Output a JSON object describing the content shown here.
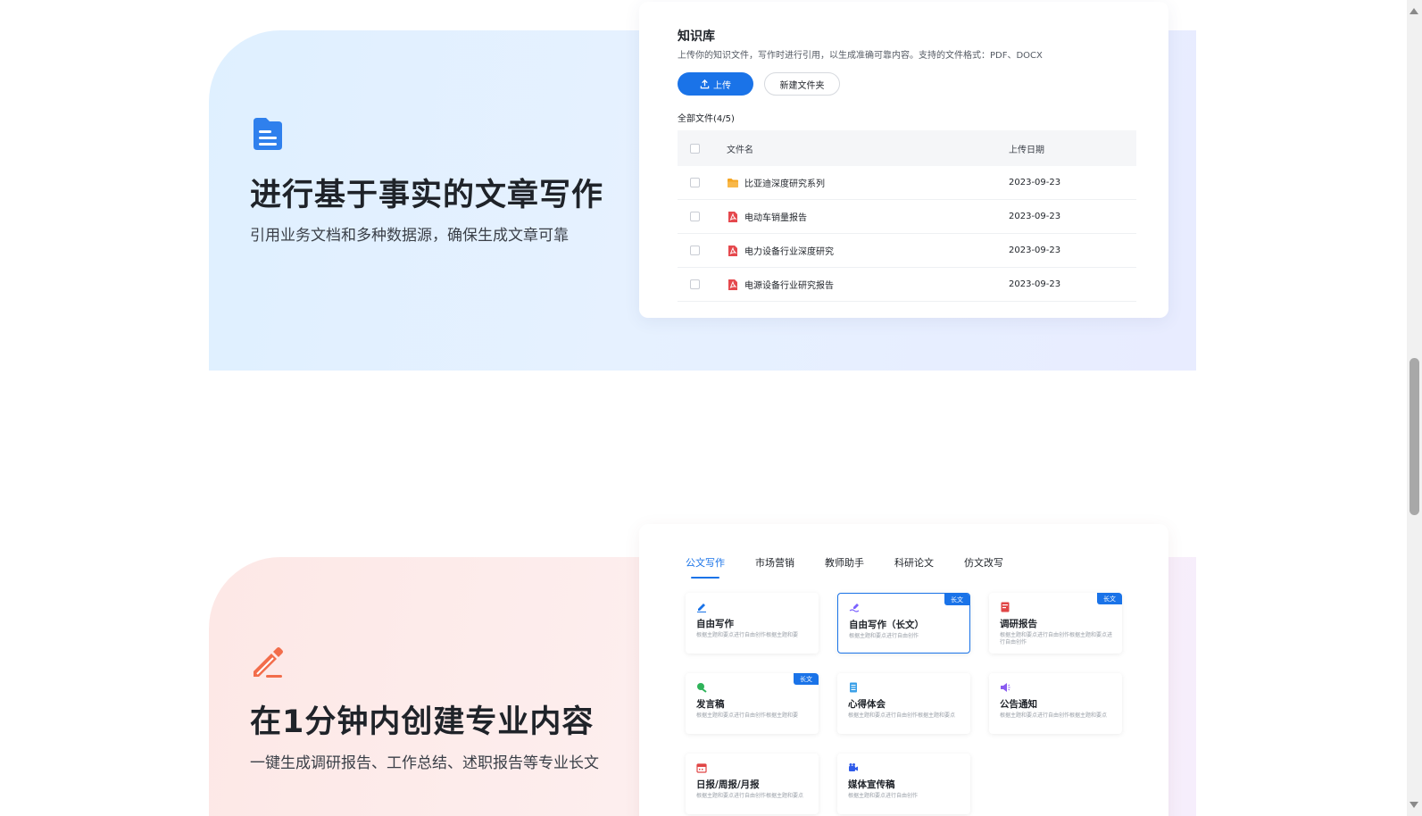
{
  "section_fact": {
    "title": "进行基于事实的文章写作",
    "subtitle": "引用业务文档和多种数据源，确保生成文章可靠",
    "icon": "document-icon",
    "accent": "#2f80ed"
  },
  "knowledge_base": {
    "title": "知识库",
    "description": "上传你的知识文件，写作时进行引用，以生成准确可靠内容。支持的文件格式：PDF、DOCX",
    "upload_label": "上传",
    "new_folder_label": "新建文件夹",
    "count_label": "全部文件(4/5)",
    "columns": {
      "name": "文件名",
      "date": "上传日期"
    },
    "rows": [
      {
        "name": "比亚迪深度研究系列",
        "date": "2023-09-23",
        "type": "folder"
      },
      {
        "name": "电动车销量报告",
        "date": "2023-09-23",
        "type": "pdf"
      },
      {
        "name": "电力设备行业深度研究",
        "date": "2023-09-23",
        "type": "pdf"
      },
      {
        "name": "电源设备行业研究报告",
        "date": "2023-09-23",
        "type": "pdf"
      }
    ]
  },
  "section_pro": {
    "title": "在1分钟内创建专业内容",
    "subtitle": "一键生成调研报告、工作总结、述职报告等专业长文",
    "icon": "pencil-icon",
    "accent": "#f26d4b"
  },
  "writing": {
    "tabs": [
      "公文写作",
      "市场营销",
      "教师助手",
      "科研论文",
      "仿文改写"
    ],
    "active_tab": 0,
    "badge_label": "长文",
    "templates": [
      {
        "name": "自由写作",
        "desc": "根据主题和要点进行自由创作根据主题和要",
        "icon": "pen-icon",
        "color": "#1a73e8",
        "badge": false
      },
      {
        "name": "自由写作（长文）",
        "desc": "根据主题和要点进行自由创作",
        "icon": "long-write-icon",
        "color": "#7b61ff",
        "badge": true
      },
      {
        "name": "调研报告",
        "desc": "根据主题和要点进行自由创作根据主题和要点进行自由创作",
        "icon": "report-icon",
        "color": "#e04545",
        "badge": true
      },
      {
        "name": "发言稿",
        "desc": "根据主题和要点进行自由创作根据主题和要",
        "icon": "speech-icon",
        "color": "#2fb35a",
        "badge": true
      },
      {
        "name": "心得体会",
        "desc": "根据主题和要点进行自由创作根据主题和要点",
        "icon": "notes-icon",
        "color": "#3aa0e8",
        "badge": false
      },
      {
        "name": "公告通知",
        "desc": "根据主题和要点进行自由创作根据主题和要点",
        "icon": "megaphone-icon",
        "color": "#8a5cf0",
        "badge": false
      },
      {
        "name": "日报/周报/月报",
        "desc": "根据主题和要点进行自由创作根据主题和要点",
        "icon": "calendar-icon",
        "color": "#e04545",
        "badge": false
      },
      {
        "name": "媒体宣传稿",
        "desc": "根据主题和要点进行自由创作",
        "icon": "camera-icon",
        "color": "#2f5bea",
        "badge": false
      }
    ]
  }
}
